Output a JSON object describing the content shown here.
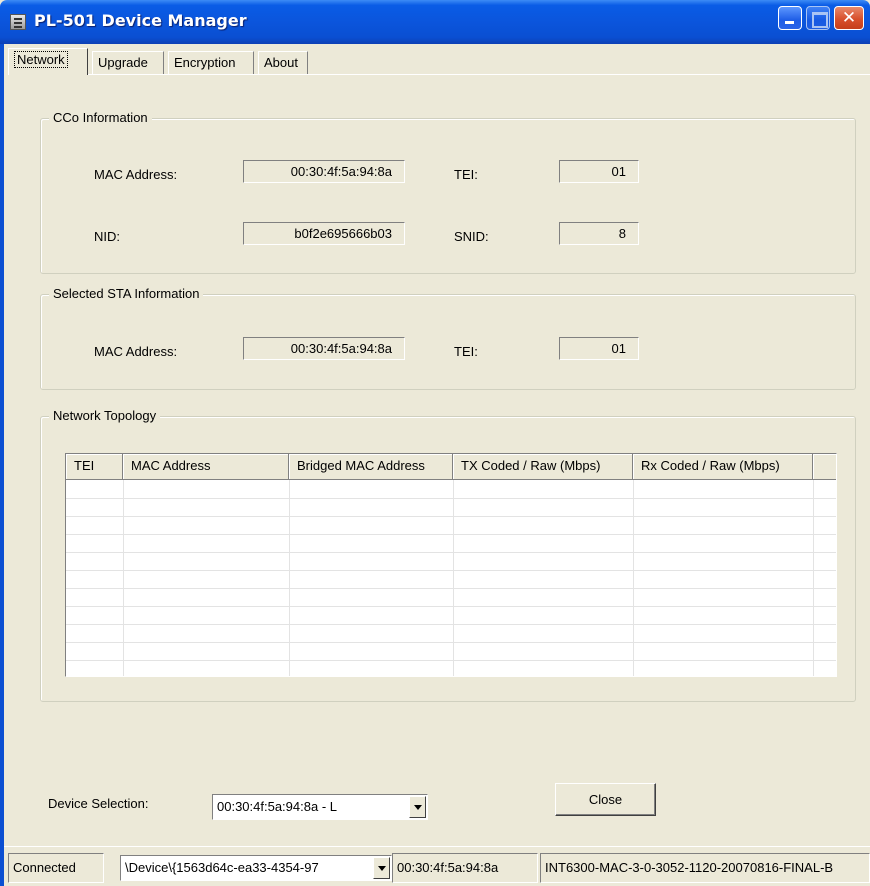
{
  "window": {
    "title": "PL-501 Device Manager",
    "close_glyph": "✕"
  },
  "tabs": [
    {
      "label": "Network",
      "active": true
    },
    {
      "label": "Upgrade",
      "active": false
    },
    {
      "label": "Encryption",
      "active": false
    },
    {
      "label": "About",
      "active": false
    }
  ],
  "cco": {
    "title": "CCo Information",
    "mac_label": "MAC Address:",
    "mac_value": "00:30:4f:5a:94:8a",
    "tei_label": "TEI:",
    "tei_value": "01",
    "nid_label": "NID:",
    "nid_value": "b0f2e695666b03",
    "snid_label": "SNID:",
    "snid_value": "8"
  },
  "sta": {
    "title": "Selected STA Information",
    "mac_label": "MAC Address:",
    "mac_value": "00:30:4f:5a:94:8a",
    "tei_label": "TEI:",
    "tei_value": "01"
  },
  "topology": {
    "title": "Network Topology",
    "columns": [
      "TEI",
      "MAC Address",
      "Bridged MAC Address",
      "TX Coded / Raw (Mbps)",
      "Rx Coded / Raw (Mbps)"
    ],
    "rows": []
  },
  "device_selection": {
    "label": "Device Selection:",
    "selected": "00:30:4f:5a:94:8a - L"
  },
  "close_button": {
    "label": "Close"
  },
  "status_bar": {
    "status": "Connected",
    "device_path": "\\Device\\{1563d64c-ea33-4354-97",
    "mac": "00:30:4f:5a:94:8a",
    "firmware": "INT6300-MAC-3-0-3052-1120-20070816-FINAL-B"
  },
  "colors": {
    "titlebar": "#0a54dc",
    "face": "#ece9d8",
    "close": "#d8502c"
  }
}
